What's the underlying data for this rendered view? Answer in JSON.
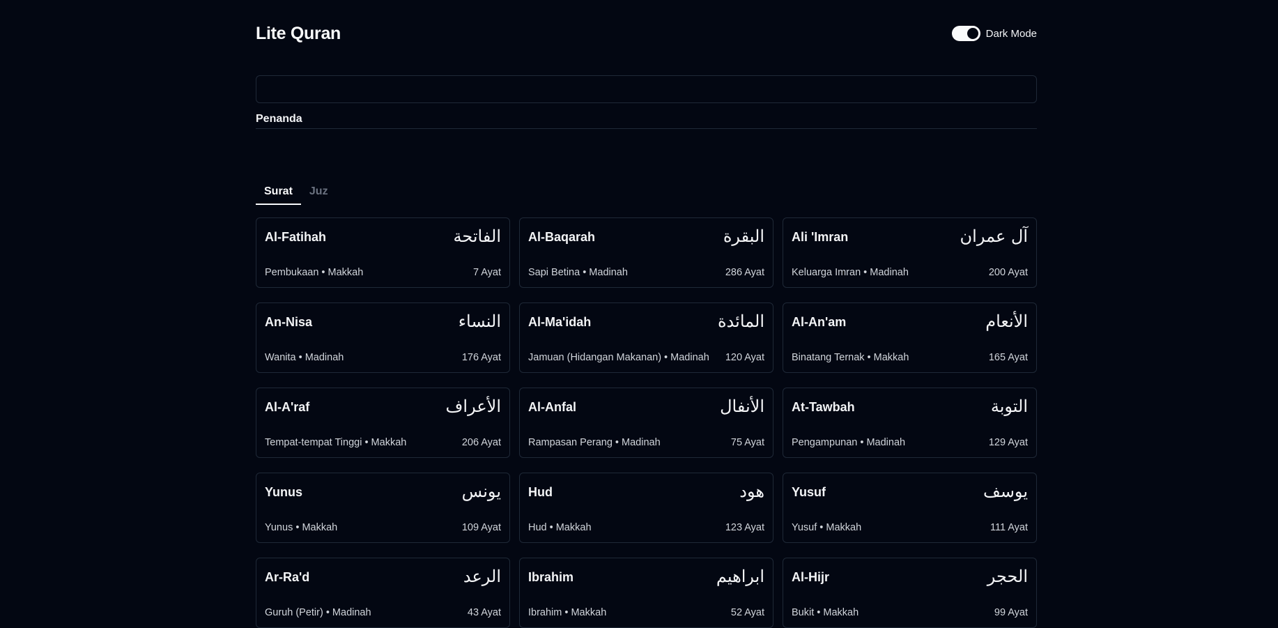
{
  "header": {
    "title": "Lite Quran",
    "dark_mode_label": "Dark Mode",
    "dark_mode_on": true
  },
  "search": {
    "value": "",
    "placeholder": ""
  },
  "bookmarks": {
    "heading": "Penanda"
  },
  "tabs": [
    {
      "label": "Surat",
      "active": true
    },
    {
      "label": "Juz",
      "active": false
    }
  ],
  "surahs": [
    {
      "name": "Al-Fatihah",
      "arabic": "الفاتحة",
      "meta": "Pembukaan • Makkah",
      "ayat": "7 Ayat"
    },
    {
      "name": "Al-Baqarah",
      "arabic": "البقرة",
      "meta": "Sapi Betina • Madinah",
      "ayat": "286 Ayat"
    },
    {
      "name": "Ali 'Imran",
      "arabic": "آل عمران",
      "meta": "Keluarga Imran • Madinah",
      "ayat": "200 Ayat"
    },
    {
      "name": "An-Nisa",
      "arabic": "النساء",
      "meta": "Wanita • Madinah",
      "ayat": "176 Ayat"
    },
    {
      "name": "Al-Ma'idah",
      "arabic": "المائدة",
      "meta": "Jamuan (Hidangan Makanan) • Madinah",
      "ayat": "120 Ayat"
    },
    {
      "name": "Al-An'am",
      "arabic": "الأنعام",
      "meta": "Binatang Ternak • Makkah",
      "ayat": "165 Ayat"
    },
    {
      "name": "Al-A'raf",
      "arabic": "الأعراف",
      "meta": "Tempat-tempat Tinggi • Makkah",
      "ayat": "206 Ayat"
    },
    {
      "name": "Al-Anfal",
      "arabic": "الأنفال",
      "meta": "Rampasan Perang • Madinah",
      "ayat": "75 Ayat"
    },
    {
      "name": "At-Tawbah",
      "arabic": "التوبة",
      "meta": "Pengampunan • Madinah",
      "ayat": "129 Ayat"
    },
    {
      "name": "Yunus",
      "arabic": "يونس",
      "meta": "Yunus • Makkah",
      "ayat": "109 Ayat"
    },
    {
      "name": "Hud",
      "arabic": "هود",
      "meta": "Hud • Makkah",
      "ayat": "123 Ayat"
    },
    {
      "name": "Yusuf",
      "arabic": "يوسف",
      "meta": "Yusuf • Makkah",
      "ayat": "111 Ayat"
    },
    {
      "name": "Ar-Ra'd",
      "arabic": "الرعد",
      "meta": "Guruh (Petir) • Madinah",
      "ayat": "43 Ayat"
    },
    {
      "name": "Ibrahim",
      "arabic": "ابراهيم",
      "meta": "Ibrahim • Makkah",
      "ayat": "52 Ayat"
    },
    {
      "name": "Al-Hijr",
      "arabic": "الحجر",
      "meta": "Bukit • Makkah",
      "ayat": "99 Ayat"
    }
  ]
}
